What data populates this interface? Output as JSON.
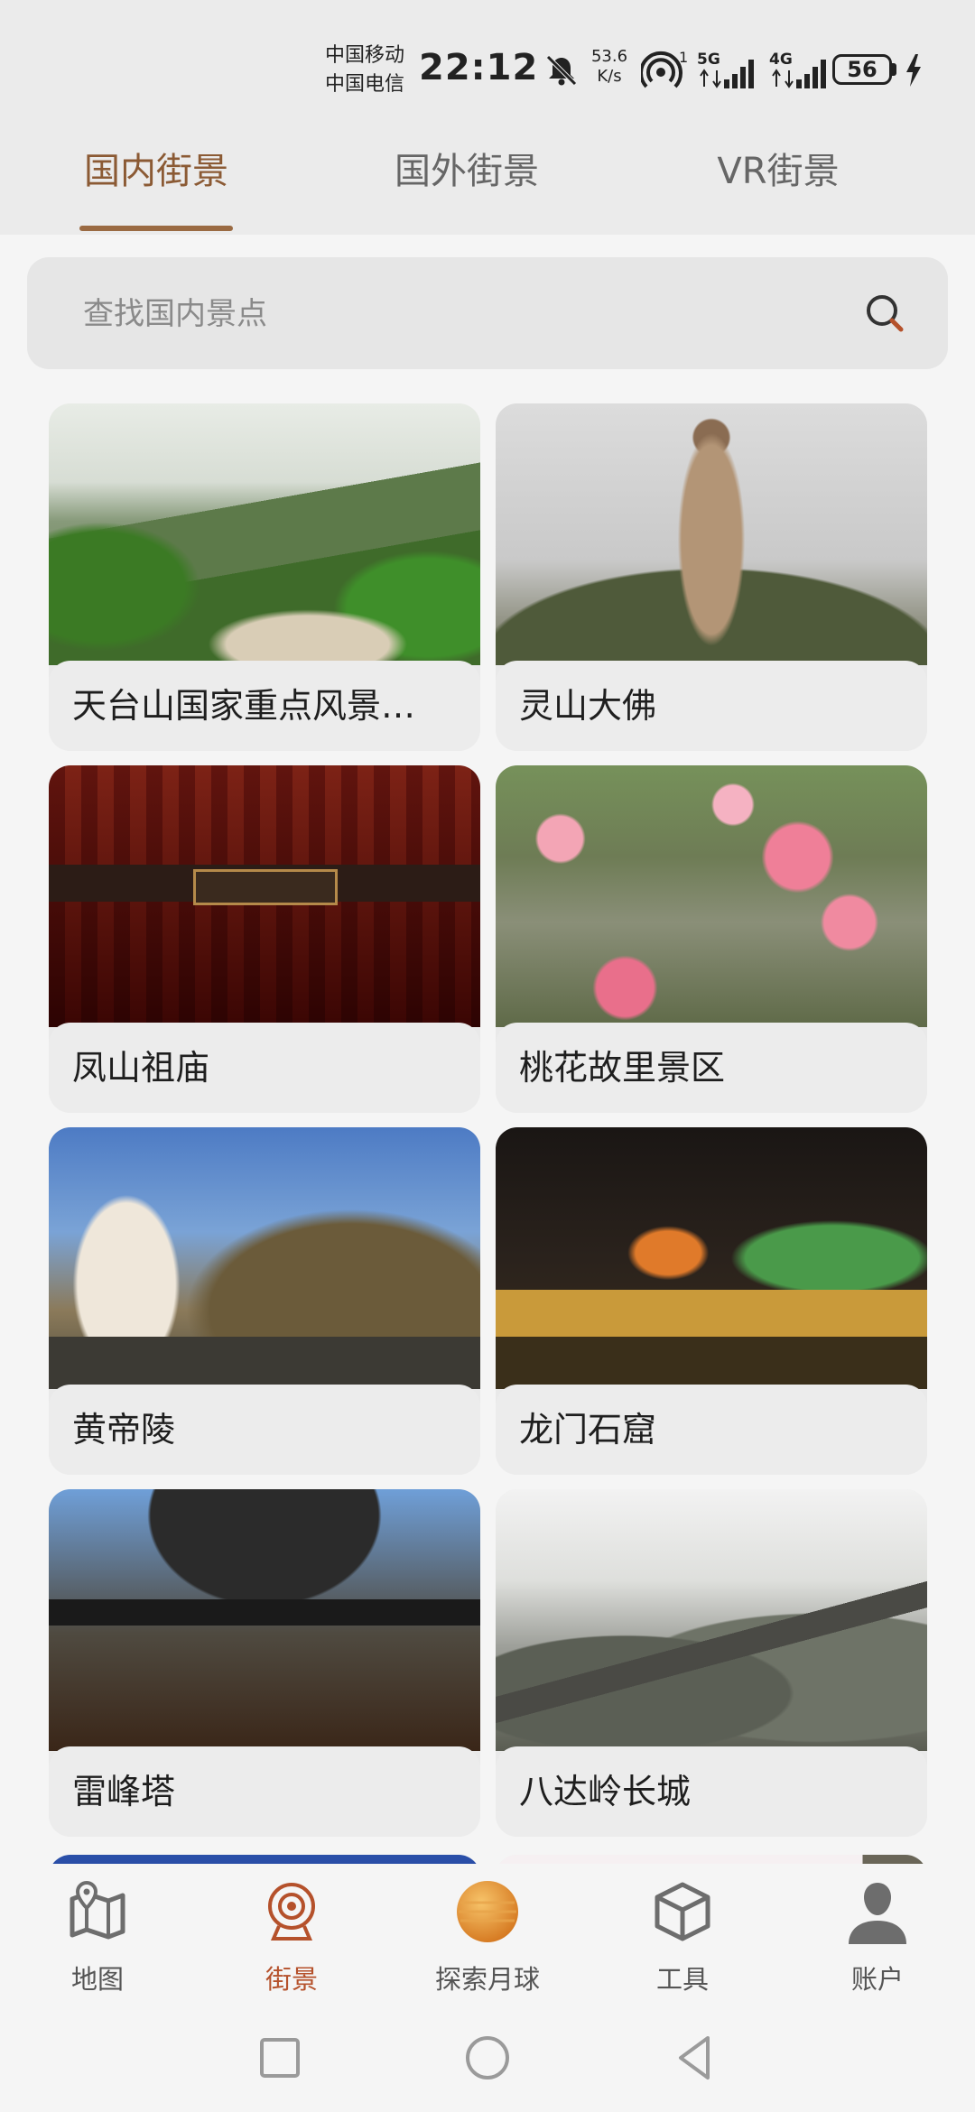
{
  "status": {
    "carrier1": "中国移动",
    "carrier2": "中国电信",
    "time": "22:12",
    "net_speed_value": "53.6",
    "net_speed_unit": "K/s",
    "hotspot_badge": "1",
    "sim1_net": "5G",
    "sim2_net": "4G",
    "battery": "56"
  },
  "tabs": [
    {
      "label": "国内街景",
      "active": true
    },
    {
      "label": "国外街景",
      "active": false
    },
    {
      "label": "VR街景",
      "active": false
    }
  ],
  "search": {
    "placeholder": "查找国内景点"
  },
  "attractions": [
    {
      "name": "天台山国家重点风景…",
      "image": "mountain-landscape"
    },
    {
      "name": "灵山大佛",
      "image": "buddha-statue"
    },
    {
      "name": "凤山祖庙",
      "image": "temple-roof"
    },
    {
      "name": "桃花故里景区",
      "image": "peach-blossom"
    },
    {
      "name": "黄帝陵",
      "image": "stone-monument"
    },
    {
      "name": "龙门石窟",
      "image": "night-lights"
    },
    {
      "name": "雷峰塔",
      "image": "pagoda"
    },
    {
      "name": "八达岭长城",
      "image": "great-wall"
    }
  ],
  "bottom_nav": [
    {
      "label": "地图",
      "icon": "map-icon",
      "active": false
    },
    {
      "label": "街景",
      "icon": "street-view-icon",
      "active": true
    },
    {
      "label": "探索月球",
      "icon": "moon-icon",
      "active": false
    },
    {
      "label": "工具",
      "icon": "cube-icon",
      "active": false
    },
    {
      "label": "账户",
      "icon": "user-icon",
      "active": false
    }
  ],
  "colors": {
    "accent": "#9a6a42",
    "active_nav": "#b5512b",
    "background": "#f5f5f5",
    "header_bg": "#ebebeb"
  }
}
